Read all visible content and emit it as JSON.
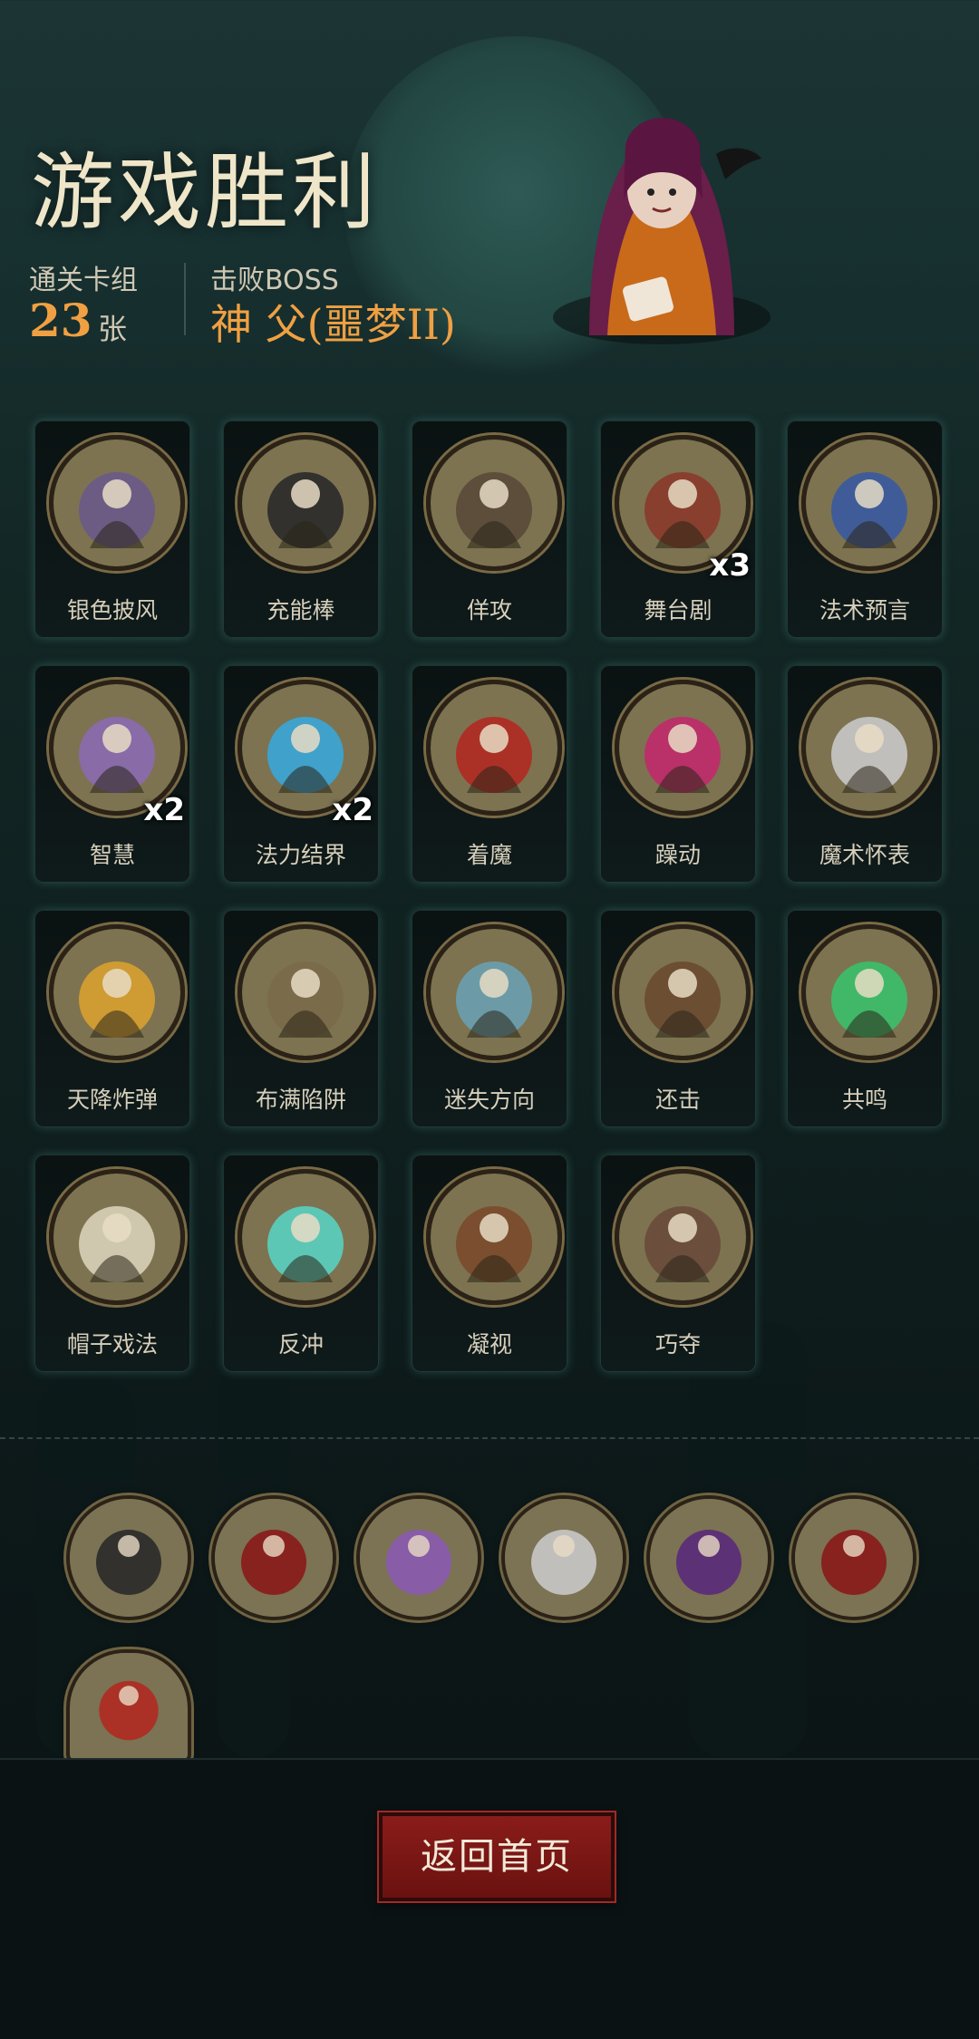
{
  "header": {
    "title": "游戏胜利",
    "deck_label": "通关卡组",
    "deck_count": "23",
    "deck_unit": "张",
    "boss_label": "击败BOSS",
    "boss_name": "神 父(噩梦II)"
  },
  "cards": [
    {
      "name": "银色披风",
      "icon": "cloak-icon",
      "color": "#6a5a8a",
      "count": ""
    },
    {
      "name": "充能棒",
      "icon": "wand-icon",
      "color": "#2a2a2a",
      "count": ""
    },
    {
      "name": "佯攻",
      "icon": "feint-icon",
      "color": "#5a4a3a",
      "count": ""
    },
    {
      "name": "舞台剧",
      "icon": "stage-play-icon",
      "color": "#8a3a2a",
      "count": "x3"
    },
    {
      "name": "法术预言",
      "icon": "crystal-ball-icon",
      "color": "#3a5aa0",
      "count": ""
    },
    {
      "name": "智慧",
      "icon": "wizard-icon",
      "color": "#8a6ab0",
      "count": "x2"
    },
    {
      "name": "法力结界",
      "icon": "barrier-icon",
      "color": "#3aa6d8",
      "count": "x2"
    },
    {
      "name": "着魔",
      "icon": "possessed-icon",
      "color": "#b02a22",
      "count": ""
    },
    {
      "name": "躁动",
      "icon": "frenzy-icon",
      "color": "#c02a6a",
      "count": ""
    },
    {
      "name": "魔术怀表",
      "icon": "pocket-watch-icon",
      "color": "#c8c8c8",
      "count": ""
    },
    {
      "name": "天降炸弹",
      "icon": "balloon-bomb-icon",
      "color": "#d8a030",
      "count": ""
    },
    {
      "name": "布满陷阱",
      "icon": "spike-trap-icon",
      "color": "#7a6a4a",
      "count": ""
    },
    {
      "name": "迷失方向",
      "icon": "signpost-icon",
      "color": "#6aa0b0",
      "count": ""
    },
    {
      "name": "还击",
      "icon": "counter-icon",
      "color": "#6a4a30",
      "count": ""
    },
    {
      "name": "共鸣",
      "icon": "skull-icon",
      "color": "#3ac06a",
      "count": ""
    },
    {
      "name": "帽子戏法",
      "icon": "rabbit-hat-icon",
      "color": "#d8d0b8",
      "count": ""
    },
    {
      "name": "反冲",
      "icon": "recoil-icon",
      "color": "#5ad0c0",
      "count": ""
    },
    {
      "name": "凝视",
      "icon": "owl-icon",
      "color": "#7a4a2a",
      "count": ""
    },
    {
      "name": "巧夺",
      "icon": "snatch-icon",
      "color": "#6a4a3a",
      "count": ""
    }
  ],
  "relics": [
    {
      "icon": "bomb-icon",
      "color": "#2a2a2a"
    },
    {
      "icon": "skull-card-icon",
      "color": "#8a1a1a"
    },
    {
      "icon": "goblin-icon",
      "color": "#8a5ab0"
    },
    {
      "icon": "slash-icon",
      "color": "#c8c8c8"
    },
    {
      "icon": "vampire-icon",
      "color": "#5a2a7a"
    },
    {
      "icon": "cursed-card-icon",
      "color": "#8a1a1a"
    },
    {
      "icon": "possessed-icon",
      "color": "#b02a22"
    }
  ],
  "footer": {
    "home_label": "返回首页"
  }
}
